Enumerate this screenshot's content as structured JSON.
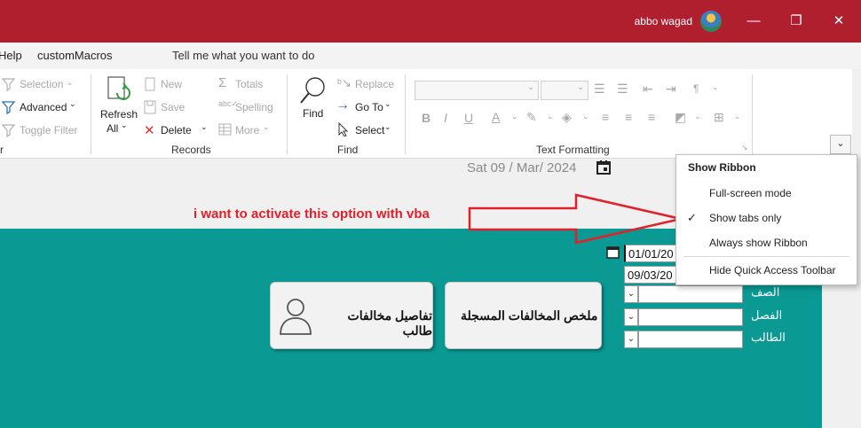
{
  "titlebar": {
    "user": "abbo wagad",
    "minimize": "—",
    "restore": "❐",
    "close": "✕"
  },
  "tabs": {
    "help": "Help",
    "custom_macros": "customMacros",
    "tell_me": "Tell me what you want to do"
  },
  "ribbon": {
    "sort_filter": {
      "selection": "Selection",
      "advanced": "Advanced",
      "toggle_filter": "Toggle Filter",
      "group_fragment": "r"
    },
    "records": {
      "refresh": "Refresh",
      "refresh_all": "All",
      "new": "New",
      "save": "Save",
      "delete": "Delete",
      "totals": "Totals",
      "spelling": "Spelling",
      "more": "More",
      "group": "Records"
    },
    "find": {
      "find": "Find",
      "replace": "Replace",
      "goto": "Go To",
      "select": "Select",
      "group": "Find"
    },
    "text_formatting": {
      "group": "Text Formatting"
    }
  },
  "header": {
    "date": "Sat 09 / Mar/ 2024"
  },
  "annotation": "i want to activate this option with vba",
  "form": {
    "btn_student_details": "تفاصيل مخالفات طالب",
    "btn_summary": "ملخص المخالفات المسجلة",
    "date_from": "01/01/20",
    "date_to": "09/03/20",
    "label_class": "الصف",
    "label_section": "الفصل",
    "label_student": "الطالب"
  },
  "menu": {
    "title": "Show Ribbon",
    "items": [
      "Full-screen mode",
      "Show tabs only",
      "Always show Ribbon",
      "Hide Quick Access Toolbar"
    ],
    "checked_index": 1
  },
  "colors": {
    "titlebar": "#b01f2e",
    "form_bg": "#0b9994",
    "annotation": "#e0202a"
  }
}
